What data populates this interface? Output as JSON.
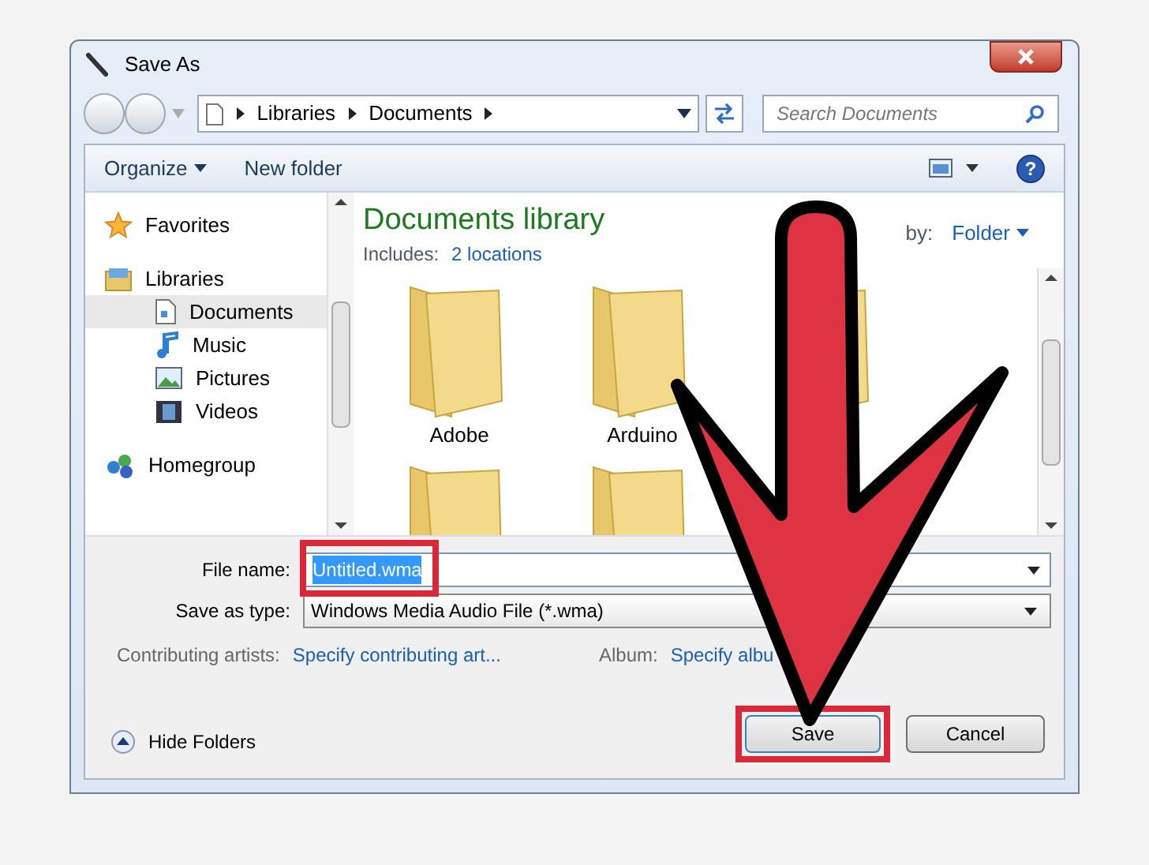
{
  "window": {
    "title": "Save As"
  },
  "address": {
    "crumbs": [
      "Libraries",
      "Documents"
    ]
  },
  "search": {
    "placeholder": "Search Documents"
  },
  "toolbar": {
    "organize": "Organize",
    "new_folder": "New folder",
    "help": "?"
  },
  "nav": [
    {
      "label": "Favorites",
      "kind": "favorites"
    },
    {
      "label": "Libraries",
      "kind": "libraries",
      "children": [
        {
          "label": "Documents",
          "kind": "documents",
          "selected": true
        },
        {
          "label": "Music",
          "kind": "music",
          "selected": false
        },
        {
          "label": "Pictures",
          "kind": "pictures",
          "selected": false
        },
        {
          "label": "Videos",
          "kind": "videos",
          "selected": false
        }
      ]
    },
    {
      "label": "Homegroup",
      "kind": "homegroup"
    }
  ],
  "library": {
    "title": "Documents library",
    "includes_label": "Includes:",
    "includes_link": "2 locations",
    "arrange_label": "by:",
    "arrange_value": "Folder"
  },
  "folders": [
    {
      "name": "Adobe"
    },
    {
      "name": "Arduino"
    }
  ],
  "form": {
    "file_name_label": "File name:",
    "file_name": "Untitled.wma",
    "file_name_selected": true,
    "type_label": "Save as type:",
    "type_value": "Windows Media Audio File (*.wma)",
    "artists_label": "Contributing artists:",
    "artists_link": "Specify contributing art...",
    "album_label": "Album:",
    "album_link": "Specify albu"
  },
  "buttons": {
    "hide_folders": "Hide Folders",
    "save": "Save",
    "cancel": "Cancel"
  }
}
